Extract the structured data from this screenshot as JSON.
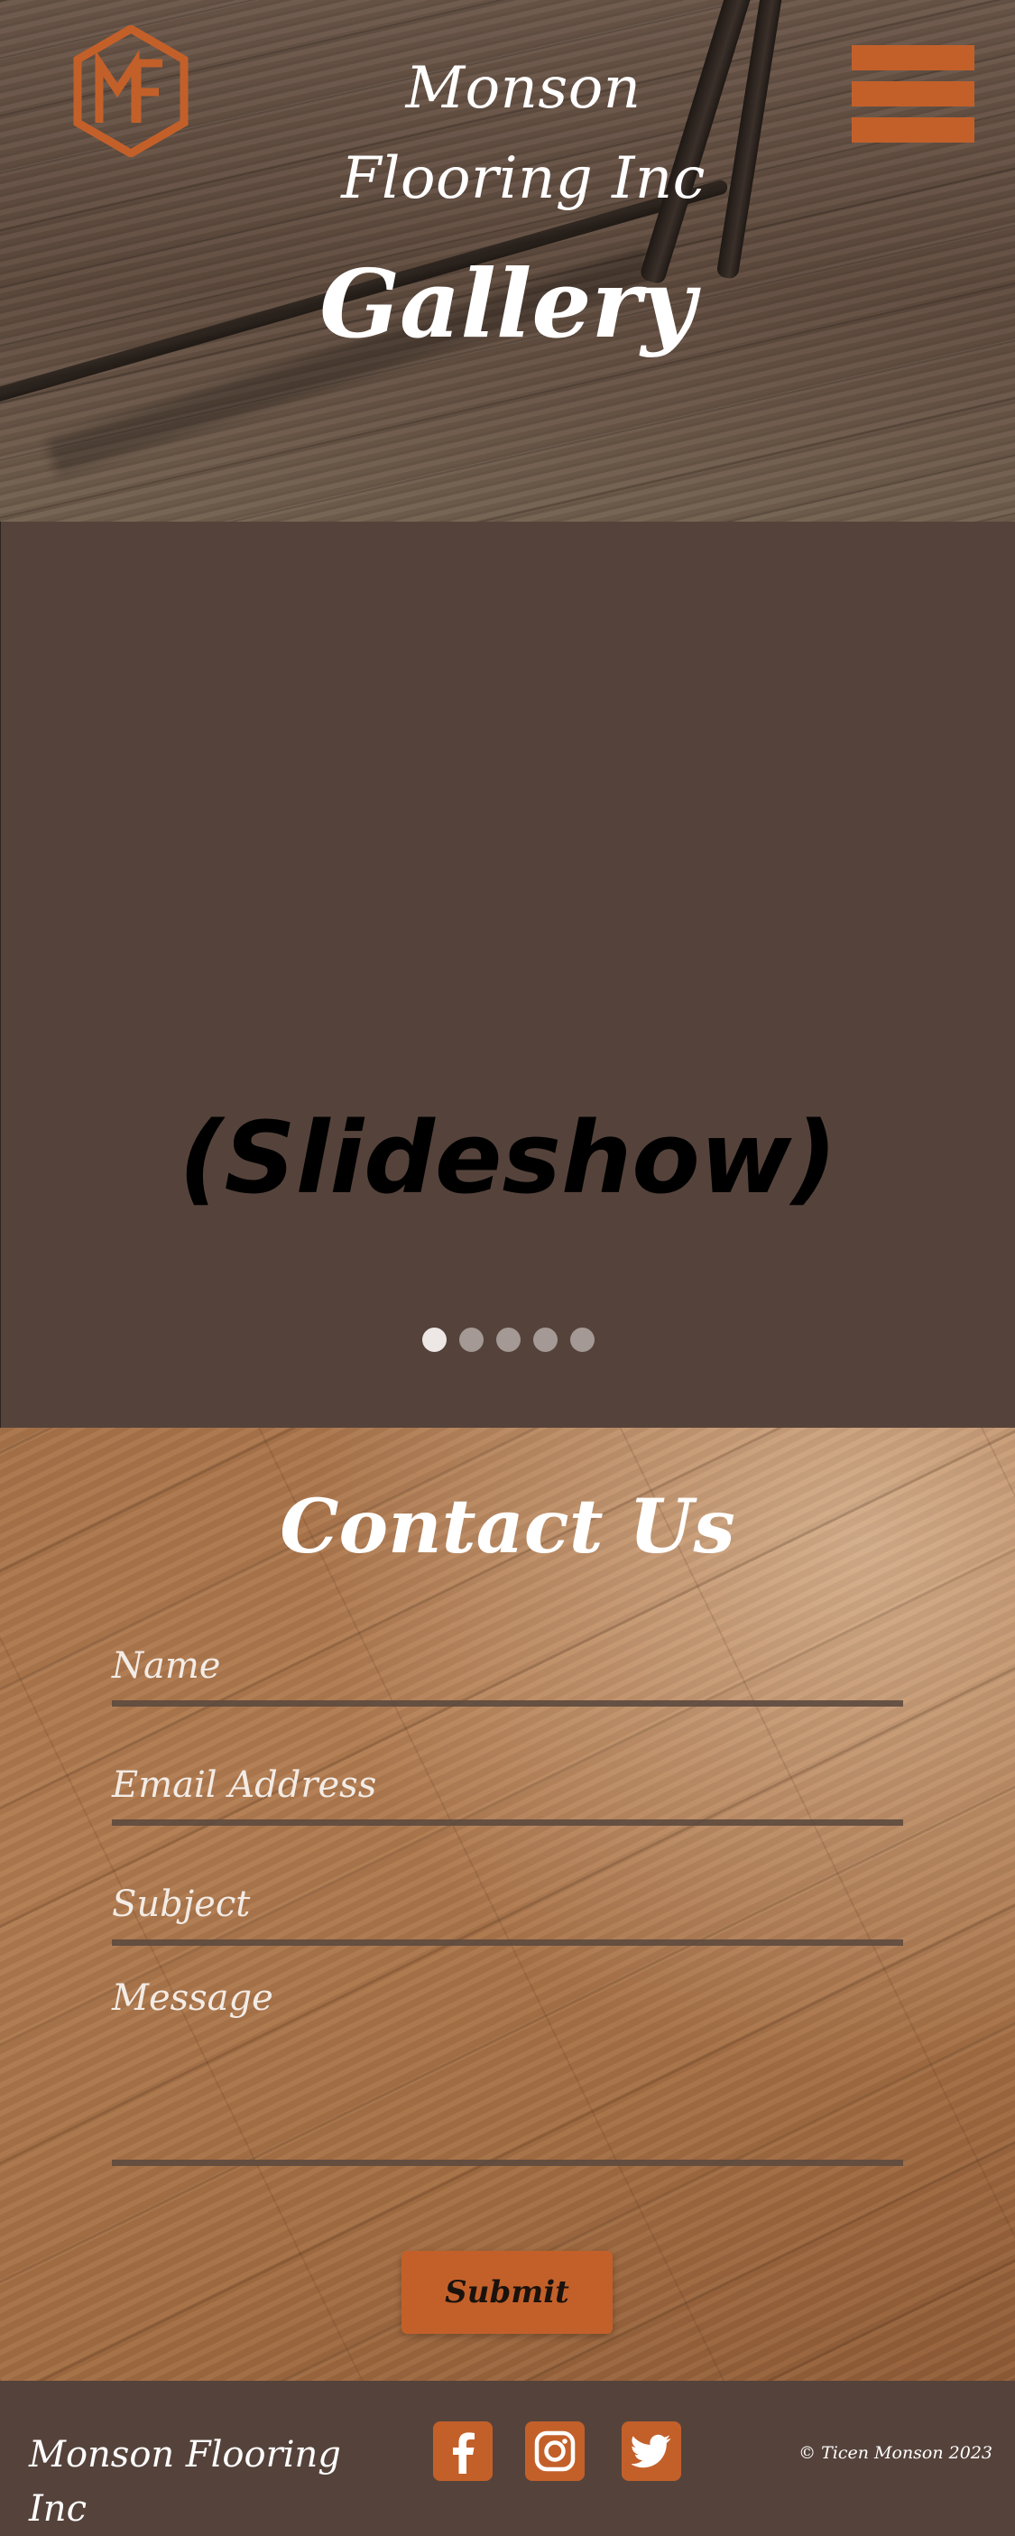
{
  "header": {
    "brand": "Monson Flooring Inc",
    "logo_icon": "mf-hexagon-logo",
    "menu_icon": "hamburger-menu-icon",
    "page_title": "Gallery"
  },
  "slideshow": {
    "label": "(Slideshow)",
    "dots": [
      {
        "active": true
      },
      {
        "active": false
      },
      {
        "active": false
      },
      {
        "active": false
      },
      {
        "active": false
      }
    ]
  },
  "contact": {
    "title": "Contact Us",
    "fields": {
      "name": {
        "placeholder": "Name",
        "value": ""
      },
      "email": {
        "placeholder": "Email Address",
        "value": ""
      },
      "subject": {
        "placeholder": "Subject",
        "value": ""
      },
      "message": {
        "placeholder": "Message",
        "value": ""
      }
    },
    "submit_label": "Submit"
  },
  "footer": {
    "brand": "Monson Flooring Inc",
    "social": [
      {
        "icon": "facebook-icon"
      },
      {
        "icon": "instagram-icon"
      },
      {
        "icon": "twitter-icon"
      }
    ],
    "copyright": "© Ticen Monson 2023"
  },
  "colors": {
    "accent": "#c3602a",
    "panel": "#55433b",
    "text_light": "#ffffff"
  }
}
